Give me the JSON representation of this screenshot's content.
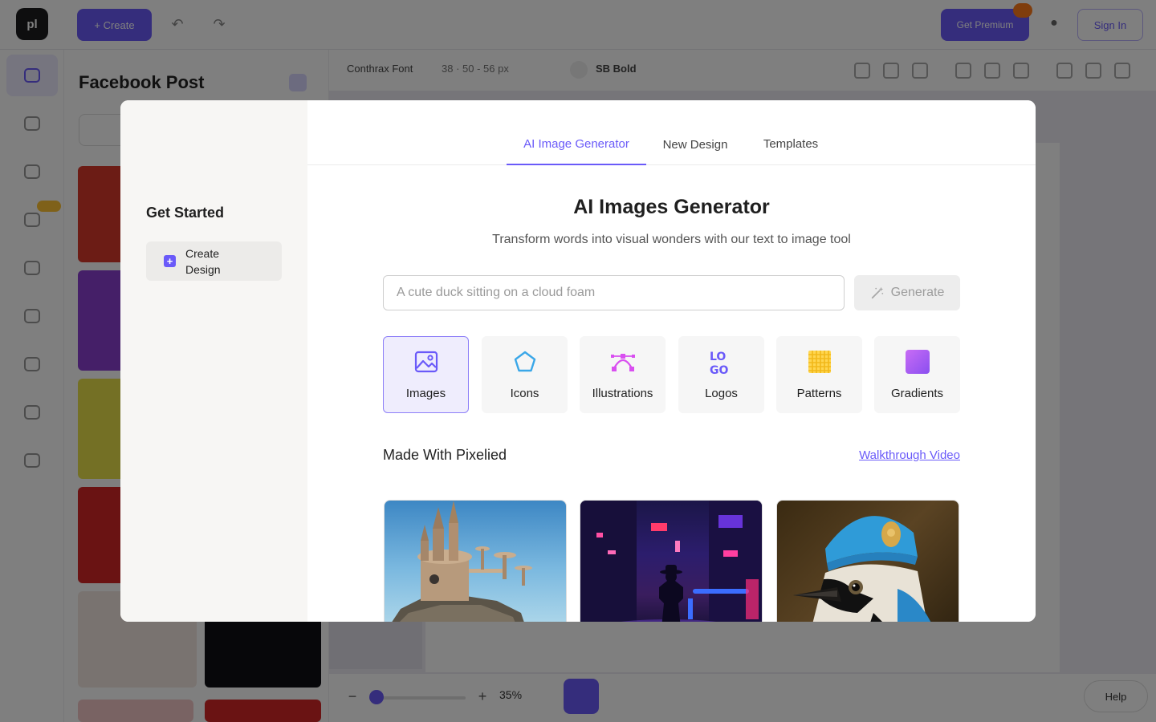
{
  "background": {
    "app_logo": "pl",
    "create_label": "+ Create",
    "upgrade_label": "Get Premium",
    "signin_label": "Sign In",
    "panel_title": "Facebook Post",
    "toolbar": {
      "font": "Conthrax Font",
      "size": "38 · 50 - 56 px",
      "weight": "SB Bold"
    },
    "zoom_value": "35%",
    "help_label": "Help"
  },
  "modal": {
    "sidebar": {
      "title": "Get Started",
      "items": [
        {
          "label": "Create Design",
          "icon": "plus-icon"
        }
      ]
    },
    "tabs": [
      {
        "label": "AI Image Generator",
        "active": true
      },
      {
        "label": "New Design",
        "active": false
      },
      {
        "label": "Templates",
        "active": false
      }
    ],
    "generator": {
      "title": "AI Images Generator",
      "subtitle": "Transform words into visual wonders with our text to image tool",
      "prompt_placeholder": "A cute duck sitting on a cloud foam",
      "prompt_value": "",
      "generate_label": "Generate",
      "generate_icon": "magic-wand-icon"
    },
    "categories": [
      {
        "label": "Images",
        "icon": "image-icon",
        "active": true
      },
      {
        "label": "Icons",
        "icon": "pentagon-icon",
        "active": false
      },
      {
        "label": "Illustrations",
        "icon": "bezier-curve-icon",
        "active": false
      },
      {
        "label": "Logos",
        "icon": "logo-letters-icon",
        "active": false
      },
      {
        "label": "Patterns",
        "icon": "pattern-grid-icon",
        "active": false
      },
      {
        "label": "Gradients",
        "icon": "gradient-square-icon",
        "active": false
      }
    ],
    "gallery": {
      "title": "Made With Pixelied",
      "link_label": "Walkthrough Video",
      "cards": [
        {
          "subject": "fantasy castle on floating rock"
        },
        {
          "subject": "neon city street with silhouette"
        },
        {
          "subject": "blue jay bird wearing knit hat"
        }
      ]
    }
  },
  "colors": {
    "accent": "#6a5af9",
    "overlay": "rgba(0,0,0,0.5)",
    "sidebar_bg": "#f7f6f4",
    "card_bg": "#f6f6f6",
    "active_card_bg": "#efedfd"
  }
}
